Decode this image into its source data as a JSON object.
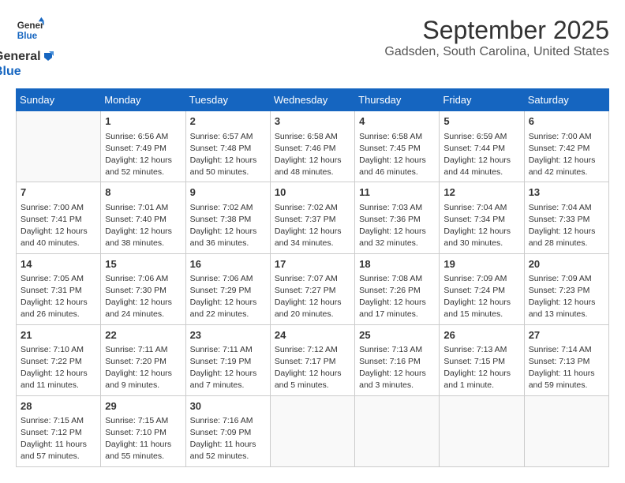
{
  "header": {
    "logo_line1": "General",
    "logo_line2": "Blue",
    "title": "September 2025",
    "subtitle": "Gadsden, South Carolina, United States"
  },
  "days_of_week": [
    "Sunday",
    "Monday",
    "Tuesday",
    "Wednesday",
    "Thursday",
    "Friday",
    "Saturday"
  ],
  "weeks": [
    [
      {
        "day": "",
        "info": ""
      },
      {
        "day": "1",
        "info": "Sunrise: 6:56 AM\nSunset: 7:49 PM\nDaylight: 12 hours\nand 52 minutes."
      },
      {
        "day": "2",
        "info": "Sunrise: 6:57 AM\nSunset: 7:48 PM\nDaylight: 12 hours\nand 50 minutes."
      },
      {
        "day": "3",
        "info": "Sunrise: 6:58 AM\nSunset: 7:46 PM\nDaylight: 12 hours\nand 48 minutes."
      },
      {
        "day": "4",
        "info": "Sunrise: 6:58 AM\nSunset: 7:45 PM\nDaylight: 12 hours\nand 46 minutes."
      },
      {
        "day": "5",
        "info": "Sunrise: 6:59 AM\nSunset: 7:44 PM\nDaylight: 12 hours\nand 44 minutes."
      },
      {
        "day": "6",
        "info": "Sunrise: 7:00 AM\nSunset: 7:42 PM\nDaylight: 12 hours\nand 42 minutes."
      }
    ],
    [
      {
        "day": "7",
        "info": "Sunrise: 7:00 AM\nSunset: 7:41 PM\nDaylight: 12 hours\nand 40 minutes."
      },
      {
        "day": "8",
        "info": "Sunrise: 7:01 AM\nSunset: 7:40 PM\nDaylight: 12 hours\nand 38 minutes."
      },
      {
        "day": "9",
        "info": "Sunrise: 7:02 AM\nSunset: 7:38 PM\nDaylight: 12 hours\nand 36 minutes."
      },
      {
        "day": "10",
        "info": "Sunrise: 7:02 AM\nSunset: 7:37 PM\nDaylight: 12 hours\nand 34 minutes."
      },
      {
        "day": "11",
        "info": "Sunrise: 7:03 AM\nSunset: 7:36 PM\nDaylight: 12 hours\nand 32 minutes."
      },
      {
        "day": "12",
        "info": "Sunrise: 7:04 AM\nSunset: 7:34 PM\nDaylight: 12 hours\nand 30 minutes."
      },
      {
        "day": "13",
        "info": "Sunrise: 7:04 AM\nSunset: 7:33 PM\nDaylight: 12 hours\nand 28 minutes."
      }
    ],
    [
      {
        "day": "14",
        "info": "Sunrise: 7:05 AM\nSunset: 7:31 PM\nDaylight: 12 hours\nand 26 minutes."
      },
      {
        "day": "15",
        "info": "Sunrise: 7:06 AM\nSunset: 7:30 PM\nDaylight: 12 hours\nand 24 minutes."
      },
      {
        "day": "16",
        "info": "Sunrise: 7:06 AM\nSunset: 7:29 PM\nDaylight: 12 hours\nand 22 minutes."
      },
      {
        "day": "17",
        "info": "Sunrise: 7:07 AM\nSunset: 7:27 PM\nDaylight: 12 hours\nand 20 minutes."
      },
      {
        "day": "18",
        "info": "Sunrise: 7:08 AM\nSunset: 7:26 PM\nDaylight: 12 hours\nand 17 minutes."
      },
      {
        "day": "19",
        "info": "Sunrise: 7:09 AM\nSunset: 7:24 PM\nDaylight: 12 hours\nand 15 minutes."
      },
      {
        "day": "20",
        "info": "Sunrise: 7:09 AM\nSunset: 7:23 PM\nDaylight: 12 hours\nand 13 minutes."
      }
    ],
    [
      {
        "day": "21",
        "info": "Sunrise: 7:10 AM\nSunset: 7:22 PM\nDaylight: 12 hours\nand 11 minutes."
      },
      {
        "day": "22",
        "info": "Sunrise: 7:11 AM\nSunset: 7:20 PM\nDaylight: 12 hours\nand 9 minutes."
      },
      {
        "day": "23",
        "info": "Sunrise: 7:11 AM\nSunset: 7:19 PM\nDaylight: 12 hours\nand 7 minutes."
      },
      {
        "day": "24",
        "info": "Sunrise: 7:12 AM\nSunset: 7:17 PM\nDaylight: 12 hours\nand 5 minutes."
      },
      {
        "day": "25",
        "info": "Sunrise: 7:13 AM\nSunset: 7:16 PM\nDaylight: 12 hours\nand 3 minutes."
      },
      {
        "day": "26",
        "info": "Sunrise: 7:13 AM\nSunset: 7:15 PM\nDaylight: 12 hours\nand 1 minute."
      },
      {
        "day": "27",
        "info": "Sunrise: 7:14 AM\nSunset: 7:13 PM\nDaylight: 11 hours\nand 59 minutes."
      }
    ],
    [
      {
        "day": "28",
        "info": "Sunrise: 7:15 AM\nSunset: 7:12 PM\nDaylight: 11 hours\nand 57 minutes."
      },
      {
        "day": "29",
        "info": "Sunrise: 7:15 AM\nSunset: 7:10 PM\nDaylight: 11 hours\nand 55 minutes."
      },
      {
        "day": "30",
        "info": "Sunrise: 7:16 AM\nSunset: 7:09 PM\nDaylight: 11 hours\nand 52 minutes."
      },
      {
        "day": "",
        "info": ""
      },
      {
        "day": "",
        "info": ""
      },
      {
        "day": "",
        "info": ""
      },
      {
        "day": "",
        "info": ""
      }
    ]
  ]
}
